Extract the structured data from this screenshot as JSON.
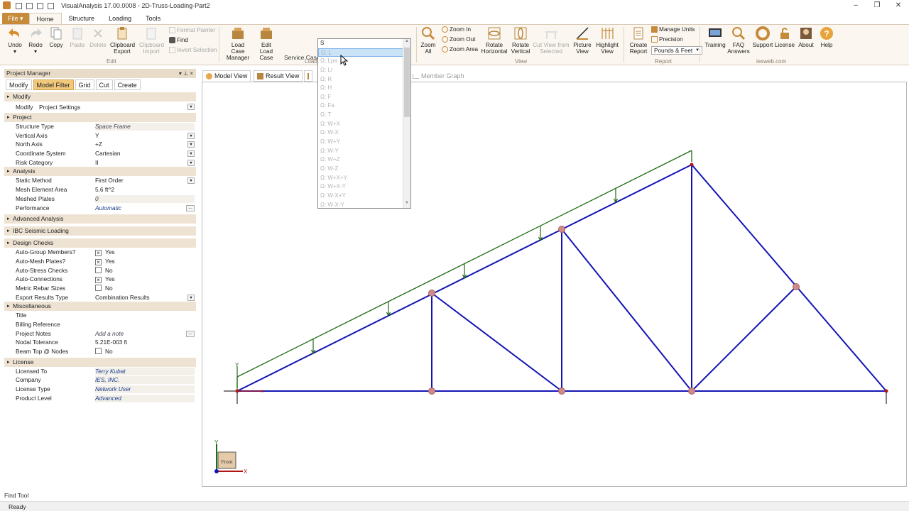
{
  "window": {
    "title": "VisualAnalysis 17.00.0008 - 2D-Truss-Loading-Part2",
    "min": "–",
    "max": "❐",
    "close": "✕"
  },
  "ribbon_tabs": [
    {
      "label": "File ▾"
    },
    {
      "label": "Home"
    },
    {
      "label": "Structure"
    },
    {
      "label": "Loading"
    },
    {
      "label": "Tools"
    }
  ],
  "ribbon": {
    "undo": "Undo",
    "redo": "Redo",
    "copy": "Copy",
    "paste": "Paste",
    "delete": "Delete",
    "clipboard_export": "Clipboard Export",
    "clipboard_import": "Clipboard Import",
    "format_painter": "Format Painter",
    "find": "Find",
    "invert_selection": "Invert Selection",
    "edit_group": "Edit",
    "load_case_manager": "Load Case Manager",
    "edit_load_case": "Edit Load Case",
    "loading_group": "Load",
    "service_case_label": "Service Case",
    "service_case_value": "S",
    "zoom_all": "Zoom All",
    "zoom_in": "Zoom In",
    "zoom_out": "Zoom Out",
    "zoom_area": "Zoom Area",
    "rotate_horizontal": "Rotate Horizontal",
    "rotate_vertical": "Rotate Vertical",
    "cut_view": "Cut View from Selected",
    "picture_view": "Picture View",
    "highlight_view": "Highlight View",
    "view_group": "View",
    "create_report": "Create Report",
    "manage_units": "Manage Units",
    "precision": "Precision",
    "units_select": "Pounds & Feet",
    "report_group": "Report",
    "training": "Training",
    "faq": "FAQ Answers",
    "support": "Support",
    "license": "License",
    "about": "About",
    "help": "Help",
    "iesweb": "iesweb.com"
  },
  "service_case_options": [
    "S",
    "Ω: L",
    "Ω: Lpa",
    "Ω: Lr",
    "Ω: R",
    "Ω: H",
    "Ω: F",
    "Ω: Fa",
    "Ω: T",
    "Ω: W+X",
    "Ω: W-X",
    "Ω: W+Y",
    "Ω: W-Y",
    "Ω: W+Z",
    "Ω: W-Z",
    "Ω: W+X+Y",
    "Ω: W+X-Y",
    "Ω: W-X+Y",
    "Ω: W-X-Y"
  ],
  "project_manager": {
    "title": "Project Manager",
    "tabs": [
      "Modify",
      "Model Filter",
      "Grid",
      "Cut",
      "Create"
    ],
    "modify_section": "Modify",
    "modify_label": "Modify",
    "modify_value": "Project Settings",
    "project_section": "Project",
    "structure_type": {
      "k": "Structure Type",
      "v": "Space Frame"
    },
    "vertical_axis": {
      "k": "Vertical Axis",
      "v": "Y"
    },
    "north_axis": {
      "k": "North Axis",
      "v": "+Z"
    },
    "coord_system": {
      "k": "Coordinate System",
      "v": "Cartesian"
    },
    "risk_category": {
      "k": "Risk Category",
      "v": "II"
    },
    "analysis_section": "Analysis",
    "static_method": {
      "k": "Static Method",
      "v": "First Order"
    },
    "mesh_area": {
      "k": "Mesh Element Area",
      "v": "5.6 ft^2"
    },
    "meshed_plates": {
      "k": "Meshed Plates",
      "v": "0"
    },
    "performance": {
      "k": "Performance",
      "v": "Automatic"
    },
    "advanced_section": "Advanced Analysis",
    "ibc_section": "IBC Seismic Loading",
    "design_section": "Design Checks",
    "auto_group": {
      "k": "Auto-Group Members?",
      "v": "Yes"
    },
    "auto_mesh": {
      "k": "Auto-Mesh Plates?",
      "v": "Yes"
    },
    "auto_stress": {
      "k": "Auto-Stress Checks",
      "v": "No"
    },
    "auto_conn": {
      "k": "Auto-Connections",
      "v": "Yes"
    },
    "metric_rebar": {
      "k": "Metric Rebar Sizes",
      "v": "No"
    },
    "export_results": {
      "k": "Export Results Type",
      "v": "Combination Results"
    },
    "misc_section": "Miscellaneous",
    "title_row": {
      "k": "Title",
      "v": ""
    },
    "billing": {
      "k": "Billing Reference",
      "v": ""
    },
    "notes": {
      "k": "Project Notes",
      "v": "Add a note"
    },
    "nodal_tol": {
      "k": "Nodal Tolerance",
      "v": "5.21E-003 ft"
    },
    "beam_top": {
      "k": "Beam Top @ Nodes",
      "v": "No"
    },
    "license_section": "License",
    "licensed_to": {
      "k": "Licensed To",
      "v": "Terry Kubat"
    },
    "company": {
      "k": "Company",
      "v": "IES, INC."
    },
    "license_type": {
      "k": "License Type",
      "v": "Network User"
    },
    "product_level": {
      "k": "Product Level",
      "v": "Advanced"
    }
  },
  "view_tabs": [
    "Model View",
    "Result View",
    "Member Graph"
  ],
  "viewport": {
    "front_label": "Front",
    "axis_x": "X",
    "axis_y": "Y",
    "member_color": "#1414b4",
    "load_color": "#1e6b14",
    "node_color": "#d08a8a"
  },
  "status": {
    "find_tool": "Find Tool",
    "ready": "Ready"
  }
}
